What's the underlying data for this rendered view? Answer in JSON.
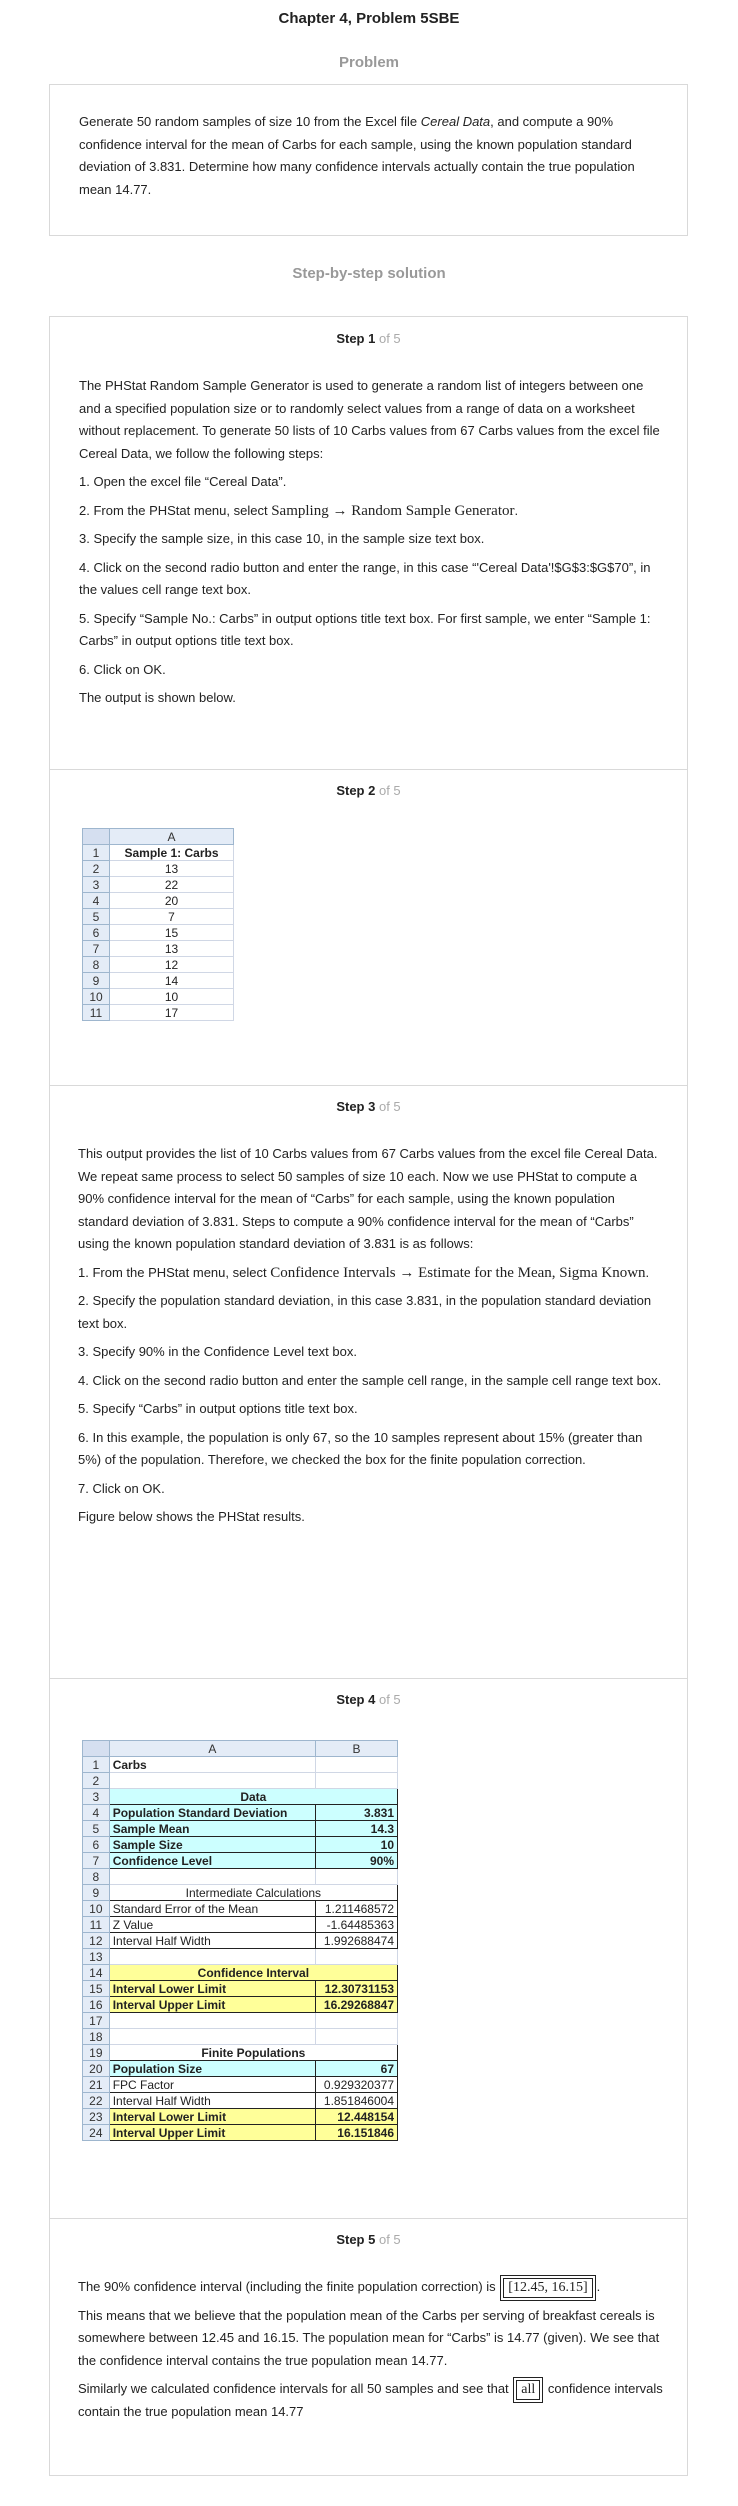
{
  "page_title": "Chapter 4, Problem 5SBE",
  "problem_heading": "Problem",
  "problem_text_a": "Generate 50 random samples of size 10 from the Excel file ",
  "problem_text_italic": "Cereal Data",
  "problem_text_b": ", and compute a 90% confidence interval for the mean of Carbs for each sample, using the known population standard deviation of 3.831. Determine how many confidence intervals actually contain the true population mean 14.77.",
  "solution_heading": "Step-by-step solution",
  "steps": [
    {
      "label": "Step 1",
      "of": "of 5"
    },
    {
      "label": "Step 2",
      "of": "of 5"
    },
    {
      "label": "Step 3",
      "of": "of 5"
    },
    {
      "label": "Step 4",
      "of": "of 5"
    },
    {
      "label": "Step 5",
      "of": "of 5"
    }
  ],
  "step1": {
    "intro": "The PHStat Random Sample Generator is used to generate a random list of integers between one and a specified population size or to randomly select values from a range of data on a worksheet without replacement. To generate 50 lists of 10 Carbs values from 67 Carbs values from the excel file Cereal Data, we follow the following steps:",
    "s1": "1. Open the excel file “Cereal Data”.",
    "s2a": "2. From the PHStat menu, select ",
    "s2m": "Sampling → Random Sample Generator",
    "s2b": ".",
    "s3": "3. Specify the sample size, in this case 10, in the sample size text box.",
    "s4": "4. Click on the second radio button and enter the range, in this case “'Cereal Data'!$G$3:$G$70”, in the values cell range text box.",
    "s5": "5. Specify “Sample No.: Carbs” in output options title text box. For first sample, we enter “Sample 1: Carbs” in output options title text box.",
    "s6": "6. Click on OK.",
    "s7": "The output is shown below."
  },
  "step2_sheet": {
    "col_header": "A",
    "rows": [
      "1",
      "2",
      "3",
      "4",
      "5",
      "6",
      "7",
      "8",
      "9",
      "10",
      "11"
    ],
    "header_cell": "Sample 1: Carbs",
    "values": [
      "13",
      "22",
      "20",
      "7",
      "15",
      "13",
      "12",
      "14",
      "10",
      "17"
    ]
  },
  "step3": {
    "intro": "This output provides the list of 10 Carbs values from 67 Carbs values from the excel file Cereal Data. We repeat same process to select 50 samples of size 10 each. Now we use PHStat to compute a 90% confidence interval for the mean of “Carbs” for each sample, using the known population standard deviation of 3.831. Steps to compute a 90% confidence interval for the mean of “Carbs” using the known population standard deviation of 3.831 is as follows:",
    "s1a": "1. From the PHStat menu, select ",
    "s1m": "Confidence Intervals → Estimate for the Mean, Sigma Known",
    "s1b": ".",
    "s2": "2. Specify the population standard deviation, in this case 3.831, in the population standard deviation text box.",
    "s3": "3. Specify 90% in the Confidence Level text box.",
    "s4": "4. Click on the second radio button and enter the sample cell range, in the sample cell range text box.",
    "s5": "5. Specify “Carbs” in output options title text box.",
    "s6": "6. In this example, the population is only 67, so the 10 samples represent about 15% (greater than 5%) of the population. Therefore, we checked the box for the finite population correction.",
    "s7": "7. Click on OK.",
    "s8": "Figure below shows the PHStat results."
  },
  "step4_sheet": {
    "col_a": "A",
    "col_b": "B",
    "r1": "Carbs",
    "r3": "Data",
    "r4": [
      "Population Standard Deviation",
      "3.831"
    ],
    "r5": [
      "Sample Mean",
      "14.3"
    ],
    "r6": [
      "Sample Size",
      "10"
    ],
    "r7": [
      "Confidence Level",
      "90%"
    ],
    "r9": "Intermediate Calculations",
    "r10": [
      "Standard Error of the Mean",
      "1.211468572"
    ],
    "r11": [
      "Z Value",
      "-1.64485363"
    ],
    "r12": [
      "Interval Half Width",
      "1.992688474"
    ],
    "r14": "Confidence Interval",
    "r15": [
      "Interval Lower Limit",
      "12.30731153"
    ],
    "r16": [
      "Interval Upper Limit",
      "16.29268847"
    ],
    "r19": "Finite Populations",
    "r20": [
      "Population Size",
      "67"
    ],
    "r21": [
      "FPC Factor",
      "0.929320377"
    ],
    "r22": [
      "Interval Half Width",
      "1.851846004"
    ],
    "r23": [
      "Interval Lower Limit",
      "12.448154"
    ],
    "r24": [
      "Interval Upper Limit",
      "16.151846"
    ]
  },
  "step5": {
    "l1a": "The 90% confidence interval (including the finite population correction) is ",
    "l1box": "[12.45, 16.15]",
    "l1b": ".",
    "p2": "This means that we believe that the population mean of the Carbs per serving of breakfast cereals is somewhere between 12.45 and 16.15. The population mean for “Carbs” is 14.77 (given). We see that the confidence interval contains the true population mean 14.77.",
    "p3a": "Similarly we calculated confidence intervals for all 50 samples and see that ",
    "p3box": "all",
    "p3b": " confidence intervals contain the true population mean 14.77"
  }
}
